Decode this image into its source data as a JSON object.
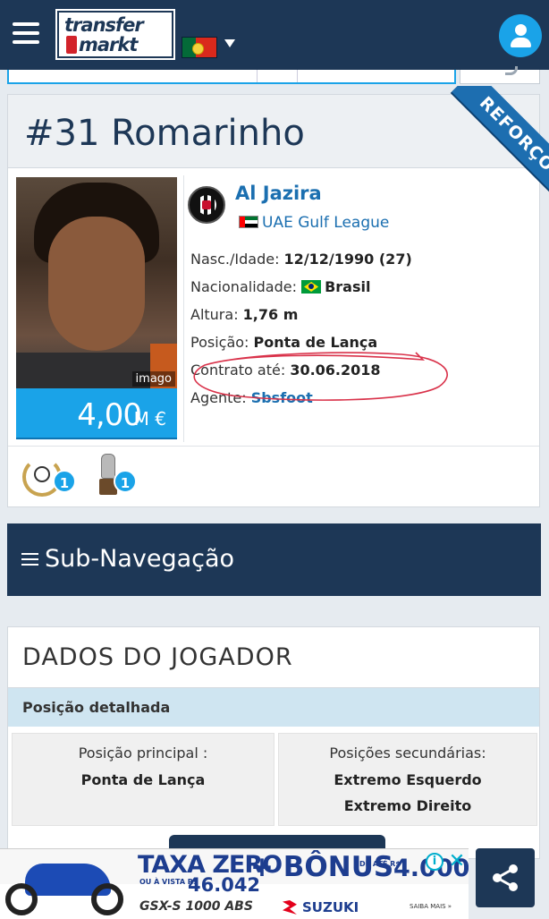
{
  "header": {
    "logo_line1": "transfer",
    "logo_line2": "markt",
    "language": "Portugal",
    "icons": {
      "menu": "hamburger-icon",
      "account": "user-icon",
      "dropdown": "chevron-down-icon"
    }
  },
  "profile": {
    "title": "#31 Romarinho",
    "ribbon": "REFORÇO",
    "photo_credit": "imago",
    "market_value": "4,00",
    "market_value_unit": "M €",
    "club": "Al Jazira",
    "league": "UAE Gulf League",
    "facts": [
      {
        "label": "Nasc./Idade:",
        "value": "12/12/1990 (27)"
      },
      {
        "label": "Nacionalidade:",
        "value": "Brasil"
      },
      {
        "label": "Altura:",
        "value": "1,76 m"
      },
      {
        "label": "Posição:",
        "value": "Ponta de Lança"
      },
      {
        "label": "Contrato até:",
        "value": "30.06.2018"
      },
      {
        "label": "Agente:",
        "value": "Sbsfoot"
      }
    ],
    "trophies": [
      {
        "icon": "champion-medal-icon",
        "count": "1"
      },
      {
        "icon": "trophy-cup-icon",
        "count": "1"
      }
    ],
    "annotation_color": "#d9324a"
  },
  "subnav": {
    "label": "Sub-Navegação"
  },
  "player_data": {
    "title": "DADOS DO JOGADOR",
    "section": "Posição detalhada",
    "main_position_header": "Posição principal :",
    "main_position": "Ponta de Lança",
    "secondary_header": "Posições secundárias:",
    "secondary_positions": [
      "Extremo Esquerdo",
      "Extremo Direito"
    ]
  },
  "ad": {
    "headline1": "TAXA ZERO",
    "small1": "OU À VISTA R$",
    "price1": "46.042",
    "plus": "+ BÔNUS",
    "small2": "DE ATÉ R$",
    "price2": "4.000",
    "model": "GSX-S 1000 ABS",
    "brand": "SUZUKI",
    "more": "SAIBA MAIS »"
  },
  "share": {
    "icon": "share-icon"
  },
  "colors": {
    "navy": "#1d3756",
    "accent": "#1aa3e8",
    "link": "#1b6fb0"
  }
}
